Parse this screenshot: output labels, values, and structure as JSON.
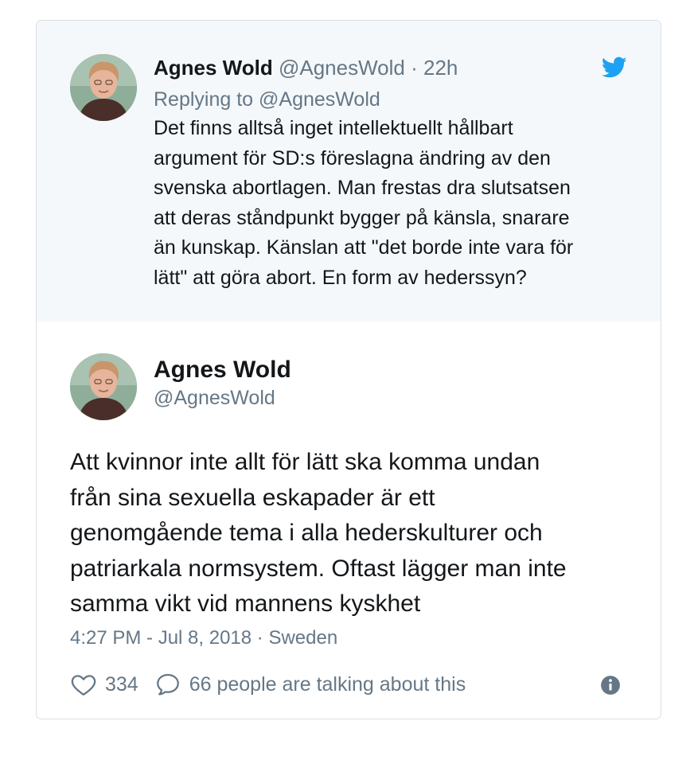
{
  "reply_tweet": {
    "author_name": "Agnes Wold",
    "author_handle": "@AgnesWold",
    "separator": "·",
    "time_ago": "22h",
    "replying_to": "Replying to @AgnesWold",
    "text_lines": [
      "Det finns alltså inget intellektuellt hållbart",
      "argument för SD:s föreslagna ändring av den",
      "svenska abortlagen. Man frestas dra slutsatsen",
      "att deras ståndpunkt bygger på känsla, snarare",
      "än kunskap. Känslan att \"det borde inte vara för",
      "lätt\" att göra abort. En form av hederssyn?"
    ],
    "platform_icon": "twitter-bird-icon"
  },
  "main_tweet": {
    "author_name": "Agnes Wold",
    "author_handle": "@AgnesWold",
    "text_lines": [
      "Att kvinnor inte allt för lätt ska komma undan",
      "från sina sexuella eskapader är ett",
      "genomgående tema i alla hederskulturer och",
      "patriarkala normsystem. Oftast lägger man inte",
      "samma vikt vid mannens kyskhet"
    ],
    "timestamp": "4:27 PM - Jul 8, 2018 · Sweden",
    "likes": "334",
    "talking": "66 people are talking about this"
  },
  "colors": {
    "twitter_blue": "#1da1f2",
    "muted_text": "#657786",
    "main_text": "#14171a",
    "reply_bg": "#f5f8fa"
  },
  "icons": [
    "heart-icon",
    "comment-bubble-icon",
    "info-icon",
    "twitter-bird-icon"
  ]
}
